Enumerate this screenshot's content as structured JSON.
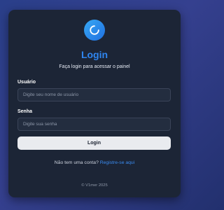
{
  "header": {
    "logo_icon": "spinner-icon",
    "title": "Login",
    "subtitle": "Faça login para acessar o painel"
  },
  "form": {
    "username_label": "Usuário",
    "username_placeholder": "Digite seu nome de usuário",
    "password_label": "Senha",
    "password_placeholder": "Digite sua senha",
    "submit_label": "Login"
  },
  "signup": {
    "prompt": "Não tem uma conta? ",
    "link_label": "Registre-se aqui"
  },
  "footer": {
    "text": "© V1mer 2025"
  },
  "colors": {
    "accent": "#2f86f0",
    "card": "#1c2536",
    "background": "#2a3f8a"
  }
}
